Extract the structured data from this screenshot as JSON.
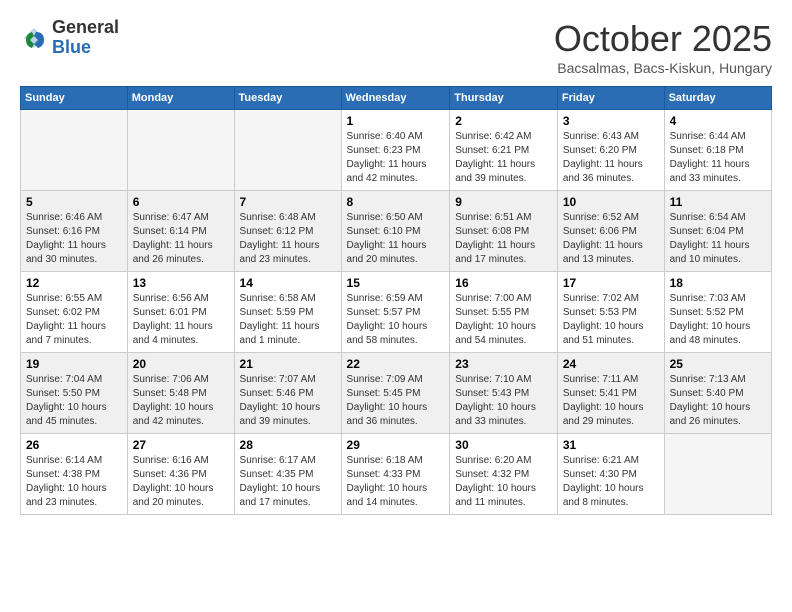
{
  "header": {
    "logo_general": "General",
    "logo_blue": "Blue",
    "month_title": "October 2025",
    "location": "Bacsalmas, Bacs-Kiskun, Hungary"
  },
  "days_of_week": [
    "Sunday",
    "Monday",
    "Tuesday",
    "Wednesday",
    "Thursday",
    "Friday",
    "Saturday"
  ],
  "weeks": [
    [
      {
        "day": "",
        "info": ""
      },
      {
        "day": "",
        "info": ""
      },
      {
        "day": "",
        "info": ""
      },
      {
        "day": "1",
        "info": "Sunrise: 6:40 AM\nSunset: 6:23 PM\nDaylight: 11 hours\nand 42 minutes."
      },
      {
        "day": "2",
        "info": "Sunrise: 6:42 AM\nSunset: 6:21 PM\nDaylight: 11 hours\nand 39 minutes."
      },
      {
        "day": "3",
        "info": "Sunrise: 6:43 AM\nSunset: 6:20 PM\nDaylight: 11 hours\nand 36 minutes."
      },
      {
        "day": "4",
        "info": "Sunrise: 6:44 AM\nSunset: 6:18 PM\nDaylight: 11 hours\nand 33 minutes."
      }
    ],
    [
      {
        "day": "5",
        "info": "Sunrise: 6:46 AM\nSunset: 6:16 PM\nDaylight: 11 hours\nand 30 minutes."
      },
      {
        "day": "6",
        "info": "Sunrise: 6:47 AM\nSunset: 6:14 PM\nDaylight: 11 hours\nand 26 minutes."
      },
      {
        "day": "7",
        "info": "Sunrise: 6:48 AM\nSunset: 6:12 PM\nDaylight: 11 hours\nand 23 minutes."
      },
      {
        "day": "8",
        "info": "Sunrise: 6:50 AM\nSunset: 6:10 PM\nDaylight: 11 hours\nand 20 minutes."
      },
      {
        "day": "9",
        "info": "Sunrise: 6:51 AM\nSunset: 6:08 PM\nDaylight: 11 hours\nand 17 minutes."
      },
      {
        "day": "10",
        "info": "Sunrise: 6:52 AM\nSunset: 6:06 PM\nDaylight: 11 hours\nand 13 minutes."
      },
      {
        "day": "11",
        "info": "Sunrise: 6:54 AM\nSunset: 6:04 PM\nDaylight: 11 hours\nand 10 minutes."
      }
    ],
    [
      {
        "day": "12",
        "info": "Sunrise: 6:55 AM\nSunset: 6:02 PM\nDaylight: 11 hours\nand 7 minutes."
      },
      {
        "day": "13",
        "info": "Sunrise: 6:56 AM\nSunset: 6:01 PM\nDaylight: 11 hours\nand 4 minutes."
      },
      {
        "day": "14",
        "info": "Sunrise: 6:58 AM\nSunset: 5:59 PM\nDaylight: 11 hours\nand 1 minute."
      },
      {
        "day": "15",
        "info": "Sunrise: 6:59 AM\nSunset: 5:57 PM\nDaylight: 10 hours\nand 58 minutes."
      },
      {
        "day": "16",
        "info": "Sunrise: 7:00 AM\nSunset: 5:55 PM\nDaylight: 10 hours\nand 54 minutes."
      },
      {
        "day": "17",
        "info": "Sunrise: 7:02 AM\nSunset: 5:53 PM\nDaylight: 10 hours\nand 51 minutes."
      },
      {
        "day": "18",
        "info": "Sunrise: 7:03 AM\nSunset: 5:52 PM\nDaylight: 10 hours\nand 48 minutes."
      }
    ],
    [
      {
        "day": "19",
        "info": "Sunrise: 7:04 AM\nSunset: 5:50 PM\nDaylight: 10 hours\nand 45 minutes."
      },
      {
        "day": "20",
        "info": "Sunrise: 7:06 AM\nSunset: 5:48 PM\nDaylight: 10 hours\nand 42 minutes."
      },
      {
        "day": "21",
        "info": "Sunrise: 7:07 AM\nSunset: 5:46 PM\nDaylight: 10 hours\nand 39 minutes."
      },
      {
        "day": "22",
        "info": "Sunrise: 7:09 AM\nSunset: 5:45 PM\nDaylight: 10 hours\nand 36 minutes."
      },
      {
        "day": "23",
        "info": "Sunrise: 7:10 AM\nSunset: 5:43 PM\nDaylight: 10 hours\nand 33 minutes."
      },
      {
        "day": "24",
        "info": "Sunrise: 7:11 AM\nSunset: 5:41 PM\nDaylight: 10 hours\nand 29 minutes."
      },
      {
        "day": "25",
        "info": "Sunrise: 7:13 AM\nSunset: 5:40 PM\nDaylight: 10 hours\nand 26 minutes."
      }
    ],
    [
      {
        "day": "26",
        "info": "Sunrise: 6:14 AM\nSunset: 4:38 PM\nDaylight: 10 hours\nand 23 minutes."
      },
      {
        "day": "27",
        "info": "Sunrise: 6:16 AM\nSunset: 4:36 PM\nDaylight: 10 hours\nand 20 minutes."
      },
      {
        "day": "28",
        "info": "Sunrise: 6:17 AM\nSunset: 4:35 PM\nDaylight: 10 hours\nand 17 minutes."
      },
      {
        "day": "29",
        "info": "Sunrise: 6:18 AM\nSunset: 4:33 PM\nDaylight: 10 hours\nand 14 minutes."
      },
      {
        "day": "30",
        "info": "Sunrise: 6:20 AM\nSunset: 4:32 PM\nDaylight: 10 hours\nand 11 minutes."
      },
      {
        "day": "31",
        "info": "Sunrise: 6:21 AM\nSunset: 4:30 PM\nDaylight: 10 hours\nand 8 minutes."
      },
      {
        "day": "",
        "info": ""
      }
    ]
  ]
}
